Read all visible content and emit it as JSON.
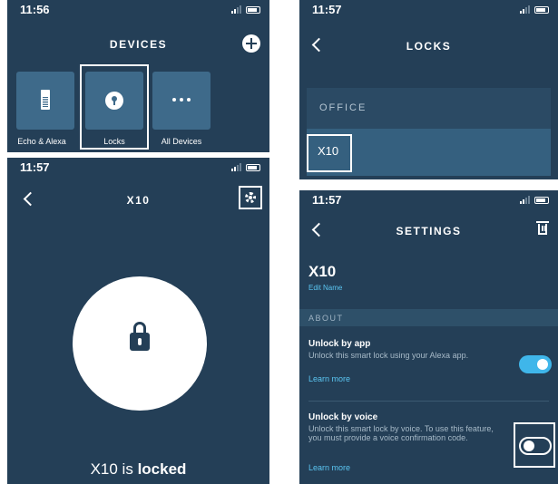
{
  "colors": {
    "background": "#243f57",
    "accent": "#3fb6ea",
    "link": "#5bc6f2",
    "tile": "#3e6a8a"
  },
  "devices_screen": {
    "time": "11:56",
    "title": "DEVICES",
    "add_icon": "plus-circle-icon",
    "tiles": [
      {
        "label": "Echo & Alexa",
        "icon": "echo-speaker-icon"
      },
      {
        "label": "Locks",
        "icon": "keyhole-icon",
        "highlighted": true
      },
      {
        "label": "All Devices",
        "icon": "ellipsis-icon"
      }
    ]
  },
  "locks_screen": {
    "time": "11:57",
    "title": "LOCKS",
    "section": "OFFICE",
    "item": "X10"
  },
  "lock_screen": {
    "time": "11:57",
    "title": "X10",
    "settings_icon": "gear-icon",
    "lock_icon": "padlock-icon",
    "status_prefix": "X10 is ",
    "status_state": "locked"
  },
  "settings_screen": {
    "time": "11:57",
    "title": "SETTINGS",
    "delete_icon": "trash-icon",
    "device_name": "X10",
    "edit_name": "Edit Name",
    "section": "ABOUT",
    "unlock_by_app": {
      "title": "Unlock by app",
      "description": "Unlock this smart lock using your Alexa app.",
      "link": "Learn more",
      "enabled": true
    },
    "unlock_by_voice": {
      "title": "Unlock by voice",
      "description": "Unlock this smart lock by voice. To use this feature, you must provide a voice confirmation code.",
      "link": "Learn more",
      "enabled": false
    }
  }
}
